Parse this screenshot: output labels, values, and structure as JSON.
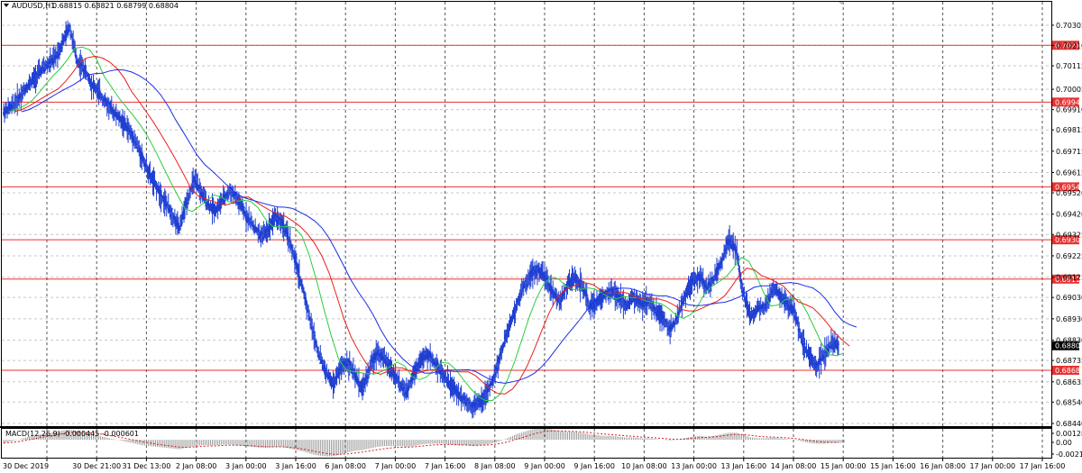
{
  "chart_header": {
    "symbol_text": "AUDUSD,H1",
    "ohlc_text": "0.68815 0.68821 0.68799 0.68804"
  },
  "indicator_header": {
    "text": "MACD(12,26,9) -0.000445 -0.000601"
  },
  "colors": {
    "background": "#ffffff",
    "grid": "#c8c8c8",
    "vgrid": "#555555",
    "candle": "#1f3fd2",
    "ma_fast": "#2ecc40",
    "ma_mid": "#e8201c",
    "ma_slow": "#1a2ee8",
    "level": "#e83232",
    "macd": "#9a9a9a",
    "signal": "#d21e1e",
    "current_bg": "#000000"
  },
  "chart_data": {
    "type": "line",
    "x_labels": [
      "30 Dec 2019",
      "30 Dec 21:00",
      "31 Dec 13:00",
      "2 Jan 08:00",
      "3 Jan 00:00",
      "3 Jan 16:00",
      "6 Jan 08:00",
      "7 Jan 00:00",
      "7 Jan 16:00",
      "8 Jan 08:00",
      "9 Jan 00:00",
      "9 Jan 16:00",
      "10 Jan 08:00",
      "13 Jan 00:00",
      "13 Jan 16:00",
      "14 Jan 08:00",
      "15 Jan 00:00",
      "15 Jan 16:00",
      "16 Jan 08:00",
      "17 Jan 00:00",
      "17 Jan 16:00"
    ],
    "y_ticks": [
      "0.70305",
      "0.70210",
      "0.70115",
      "0.70005",
      "0.69910",
      "0.69815",
      "0.69715",
      "0.69615",
      "0.69520",
      "0.69420",
      "0.69325",
      "0.69225",
      "0.69125",
      "0.69030",
      "0.68930",
      "0.68830",
      "0.68735",
      "0.68635",
      "0.68540",
      "0.68440"
    ],
    "ylim": [
      0.6844,
      0.70305
    ],
    "levels": [
      "0.70211",
      "0.69945",
      "0.69548",
      "0.69300",
      "0.69116",
      "0.68689"
    ],
    "current_price": "0.68804",
    "close_series": [
      0.699,
      0.6992,
      0.6996,
      0.7001,
      0.7005,
      0.7009,
      0.7012,
      0.7015,
      0.7022,
      0.703,
      0.7014,
      0.701,
      0.7003,
      0.6999,
      0.6994,
      0.699,
      0.6986,
      0.6982,
      0.6976,
      0.6968,
      0.696,
      0.6954,
      0.6948,
      0.6942,
      0.6935,
      0.6948,
      0.6958,
      0.6952,
      0.6946,
      0.6944,
      0.6949,
      0.6953,
      0.6948,
      0.6942,
      0.6937,
      0.6932,
      0.6934,
      0.6941,
      0.6938,
      0.693,
      0.6918,
      0.6905,
      0.689,
      0.6877,
      0.6868,
      0.6862,
      0.687,
      0.6873,
      0.6866,
      0.686,
      0.687,
      0.6878,
      0.6874,
      0.6869,
      0.6863,
      0.6858,
      0.6868,
      0.6874,
      0.6876,
      0.6872,
      0.6867,
      0.6862,
      0.6858,
      0.6855,
      0.6852,
      0.6854,
      0.6858,
      0.6866,
      0.6878,
      0.6889,
      0.6899,
      0.6908,
      0.6914,
      0.6916,
      0.6912,
      0.6905,
      0.6901,
      0.6909,
      0.6912,
      0.6908,
      0.6899,
      0.6901,
      0.6904,
      0.6906,
      0.6903,
      0.6899,
      0.6903,
      0.69,
      0.6901,
      0.6897,
      0.6894,
      0.6888,
      0.6894,
      0.6903,
      0.691,
      0.6913,
      0.6907,
      0.6912,
      0.692,
      0.693,
      0.6925,
      0.6905,
      0.6894,
      0.6898,
      0.6899,
      0.6907,
      0.6904,
      0.69,
      0.6896,
      0.6883,
      0.6875,
      0.6871,
      0.6876,
      0.6881,
      0.688
    ],
    "macd_series": [
      -0.0004,
      -0.0002,
      0.0,
      0.0003,
      0.0005,
      0.0007,
      0.0008,
      0.001,
      0.0012,
      0.0013,
      0.0011,
      0.0009,
      0.0007,
      0.0005,
      0.0003,
      0.0001,
      -0.0001,
      -0.0003,
      -0.0005,
      -0.0007,
      -0.0008,
      -0.0009,
      -0.001,
      -0.0011,
      -0.0012,
      -0.001,
      -0.0008,
      -0.0007,
      -0.0007,
      -0.0007,
      -0.0006,
      -0.0006,
      -0.0007,
      -0.0008,
      -0.0009,
      -0.001,
      -0.001,
      -0.0009,
      -0.0009,
      -0.0011,
      -0.0013,
      -0.0015,
      -0.0018,
      -0.002,
      -0.0021,
      -0.0021,
      -0.0019,
      -0.0016,
      -0.0014,
      -0.0013,
      -0.0011,
      -0.0009,
      -0.0008,
      -0.0008,
      -0.0008,
      -0.0009,
      -0.0008,
      -0.0006,
      -0.0005,
      -0.0005,
      -0.0005,
      -0.0006,
      -0.0007,
      -0.0007,
      -0.0008,
      -0.0007,
      -0.0006,
      -0.0004,
      -0.0001,
      0.0003,
      0.0007,
      0.001,
      0.0013,
      0.0015,
      0.0015,
      0.0013,
      0.0011,
      0.001,
      0.001,
      0.0009,
      0.0007,
      0.0006,
      0.0005,
      0.0005,
      0.0004,
      0.0003,
      0.0003,
      0.0002,
      0.0002,
      0.0001,
      0.0,
      -0.0001,
      0.0,
      0.0002,
      0.0004,
      0.0005,
      0.0004,
      0.0005,
      0.0007,
      0.0009,
      0.0009,
      0.0006,
      0.0003,
      0.0002,
      0.0002,
      0.0003,
      0.0002,
      0.0001,
      0.0,
      -0.0002,
      -0.0004,
      -0.0005,
      -0.0005,
      -0.0004,
      -0.0004
    ],
    "macd_ylim": [
      -0.00216,
      0.00128
    ],
    "macd_y_ticks": [
      "0.00128",
      "0.00",
      "-0.00216"
    ]
  }
}
